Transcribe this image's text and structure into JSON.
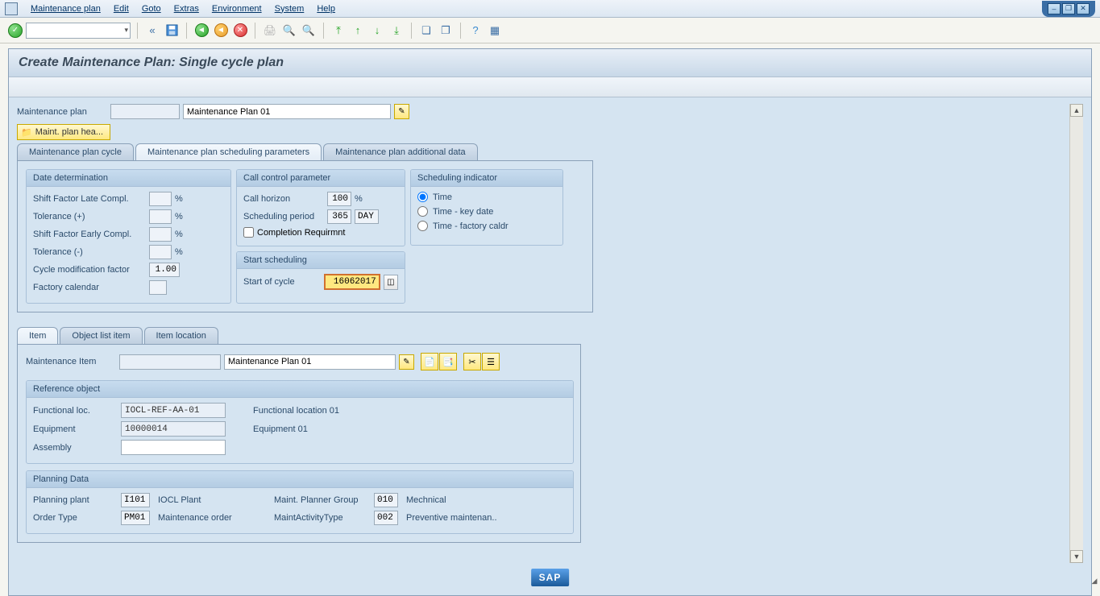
{
  "menu": {
    "items": [
      "Maintenance plan",
      "Edit",
      "Goto",
      "Extras",
      "Environment",
      "System",
      "Help"
    ]
  },
  "page_title": "Create Maintenance Plan: Single cycle plan",
  "header": {
    "plan_label": "Maintenance plan",
    "plan_code": "",
    "plan_desc": "Maintenance Plan 01",
    "folder_button": "Maint. plan hea..."
  },
  "tabs_top": [
    "Maintenance plan cycle",
    "Maintenance plan scheduling parameters",
    "Maintenance plan additional data"
  ],
  "tabs_top_active": 1,
  "date_det": {
    "title": "Date determination",
    "shift_late_lbl": "Shift Factor Late Compl.",
    "shift_late_val": "",
    "tol_plus_lbl": "Tolerance (+)",
    "tol_plus_val": "",
    "shift_early_lbl": "Shift Factor Early Compl.",
    "shift_early_val": "",
    "tol_minus_lbl": "Tolerance (-)",
    "tol_minus_val": "",
    "cycle_mod_lbl": "Cycle modification factor",
    "cycle_mod_val": "1.00",
    "factory_cal_lbl": "Factory calendar",
    "factory_cal_val": ""
  },
  "call_ctrl": {
    "title": "Call control parameter",
    "horizon_lbl": "Call horizon",
    "horizon_val": "100",
    "sched_period_lbl": "Scheduling period",
    "sched_period_val": "365",
    "sched_period_unit": "DAY",
    "completion_lbl": "Completion Requirmnt"
  },
  "sched_ind": {
    "title": "Scheduling indicator",
    "opt_time": "Time",
    "opt_key": "Time - key date",
    "opt_cal": "Time - factory caldr"
  },
  "start_sched": {
    "title": "Start scheduling",
    "start_lbl": "Start of cycle",
    "start_val": "16062017"
  },
  "tabs_item": [
    "Item",
    "Object list item",
    "Item location"
  ],
  "tabs_item_active": 0,
  "maint_item": {
    "lbl": "Maintenance Item",
    "code": "",
    "desc": "Maintenance Plan 01"
  },
  "ref_obj": {
    "title": "Reference object",
    "func_loc_lbl": "Functional loc.",
    "func_loc_val": "IOCL-REF-AA-01",
    "func_loc_desc": "Functional location 01",
    "equip_lbl": "Equipment",
    "equip_val": "10000014",
    "equip_desc": "Equipment 01",
    "assembly_lbl": "Assembly",
    "assembly_val": ""
  },
  "plan_data": {
    "title": "Planning Data",
    "plant_lbl": "Planning plant",
    "plant_val": "I101",
    "plant_desc": "IOCL Plant",
    "planner_grp_lbl": "Maint. Planner Group",
    "planner_grp_val": "010",
    "planner_grp_desc": "Mechnical",
    "order_type_lbl": "Order Type",
    "order_type_val": "PM01",
    "order_type_desc": "Maintenance order",
    "activity_type_lbl": "MaintActivityType",
    "activity_type_val": "002",
    "activity_type_desc": "Preventive maintenan.."
  },
  "sap": "SAP"
}
